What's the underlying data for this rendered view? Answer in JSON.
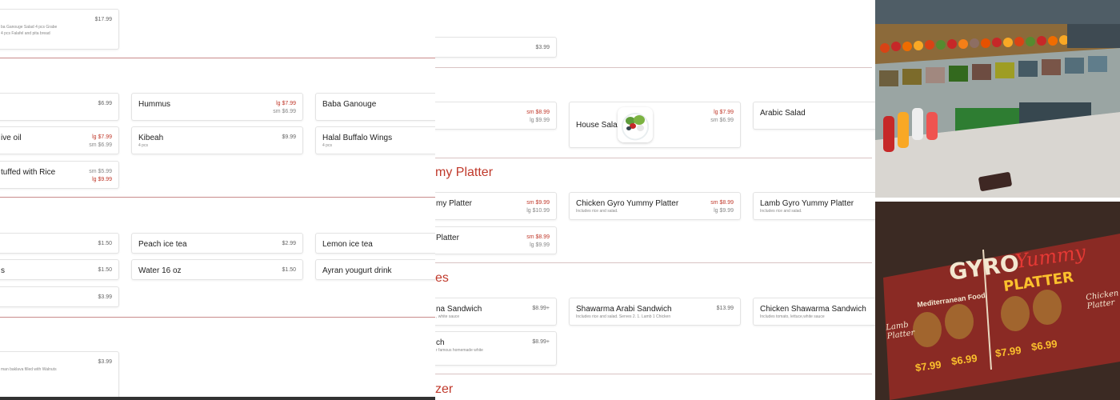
{
  "left": {
    "top_card": {
      "desc1": "ba Ganouge Salad 4 pcs Grabe",
      "desc2": "4 pcs Falafel and pita bread",
      "price": "$17.99"
    },
    "appetizers": [
      {
        "name": "",
        "price1": "$6.99"
      },
      {
        "name": "Hummus",
        "price1": "lg $7.99",
        "price2": "sm $6.99"
      },
      {
        "name": "Baba Ganouge"
      },
      {
        "name": "ive oil",
        "price1": "lg $7.99",
        "price2": "sm $6.99"
      },
      {
        "name": "Kibeah",
        "desc": "4 pcs",
        "price1": "$9.99"
      },
      {
        "name": "Halal Buffalo Wings",
        "desc": "4 pcs"
      },
      {
        "name": "tuffed with Rice",
        "price1": "sm $5.99",
        "price2": "lg $9.99"
      }
    ],
    "drinks": [
      {
        "name": "",
        "price1": "$1.50"
      },
      {
        "name": "Peach ice tea",
        "price1": "$2.99"
      },
      {
        "name": "Lemon ice tea"
      },
      {
        "name": "s",
        "price1": "$1.50"
      },
      {
        "name": "Water 16 oz",
        "price1": "$1.50"
      },
      {
        "name": "Ayran yougurt drink"
      },
      {
        "name": "",
        "price1": "$3.99"
      }
    ],
    "dessert": {
      "desc": "man baklava filled with Walnuts",
      "price": "$3.99"
    }
  },
  "mid": {
    "top_card": {
      "price": "$3.99"
    },
    "salads": [
      {
        "name": "",
        "price1": "sm $8.99",
        "price2": "lg $9.99"
      },
      {
        "name": "House Salad",
        "price1": "lg $7.99",
        "price2": "sm $6.99"
      },
      {
        "name": "Arabic Salad"
      }
    ],
    "heading_platter": "my Platter",
    "platters": [
      {
        "name": "my Platter",
        "price1": "sm $9.99",
        "price2": "lg $10.99"
      },
      {
        "name": "Chicken Gyro Yummy Platter",
        "desc": "Includes rice and salad.",
        "price1": "sm $8.99",
        "price2": "lg $9.99"
      },
      {
        "name": "Lamb Gyro Yummy Platter",
        "desc": "Includes rice and salad."
      },
      {
        "name": "Platter",
        "price1": "sm $8.99",
        "price2": "lg $9.99"
      }
    ],
    "heading_sandwich": "es",
    "sandwiches": [
      {
        "name": "na Sandwich",
        "desc": ", white sauce",
        "price1": "$8.99+"
      },
      {
        "name": "Shawarma Arabi Sandwich",
        "desc": "Includes rice and salad. Serves 2. 1. Lamb 1 Chicken",
        "price1": "$13.99"
      },
      {
        "name": "Chicken Shawarma Sandwich",
        "desc": "Includes tomato, lettuce,white sauce"
      },
      {
        "name": "ch",
        "desc": "r famous homemade white",
        "price1": "$8.99+"
      }
    ],
    "heading_bottom": "zer"
  },
  "photo_bottom": {
    "sign_title1": "GYRO",
    "sign_title2": "Yummy",
    "sign_title3": "PLATTER",
    "sign_subtitle": "Mediterranean Food",
    "left_label": "Lamb Platter",
    "right_label": "Chicken Platter",
    "prices": [
      "$7.99",
      "$6.99",
      "$7.99",
      "$6.99"
    ]
  },
  "colors": {
    "accent": "#c0392b",
    "separator": "#c98b8b"
  }
}
